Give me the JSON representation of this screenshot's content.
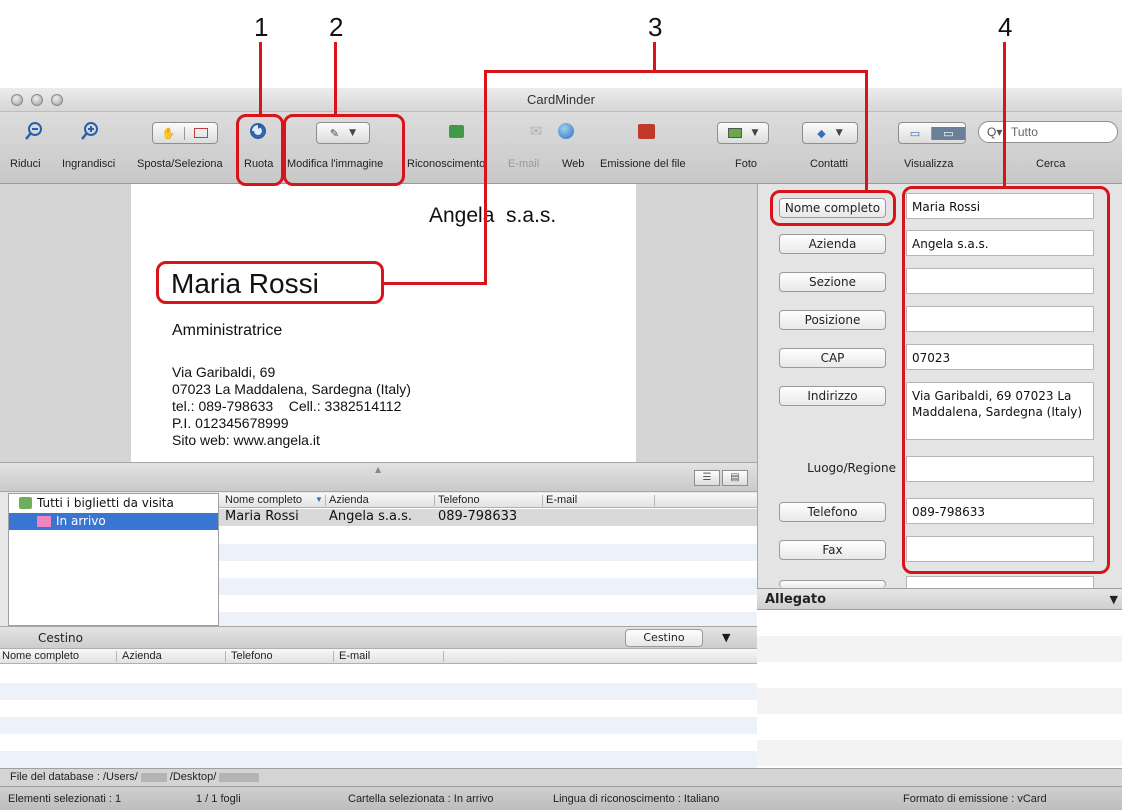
{
  "callouts": [
    "1",
    "2",
    "3",
    "4"
  ],
  "window": {
    "title": "CardMinder"
  },
  "toolbar": {
    "riduci": "Riduci",
    "ingrandisci": "Ingrandisci",
    "sposta": "Sposta/Seleziona",
    "ruota": "Ruota",
    "modifica": "Modifica l'immagine",
    "riconoscimento": "Riconoscimento",
    "email": "E-mail",
    "web": "Web",
    "emissione": "Emissione del file",
    "foto": "Foto",
    "contatti": "Contatti",
    "visualizza": "Visualizza",
    "cerca": "Cerca",
    "search_placeholder": "Tutto"
  },
  "card": {
    "company": "Angela  s.a.s.",
    "name": "Maria Rossi",
    "role": "Amministratrice",
    "address1": "Via Garibaldi, 69",
    "address2": "07023 La Maddalena, Sardegna (Italy)",
    "phones": "tel.: 089-798633    Cell.: 3382514112",
    "piva": "P.I. 012345678999",
    "web": "Sito web: www.angela.it"
  },
  "fields": [
    {
      "label": "Nome completo",
      "value": "Maria Rossi",
      "button": true
    },
    {
      "label": "Azienda",
      "value": "Angela s.a.s.",
      "button": true
    },
    {
      "label": "Sezione",
      "value": "",
      "button": true
    },
    {
      "label": "Posizione",
      "value": "",
      "button": true
    },
    {
      "label": "CAP",
      "value": "07023",
      "button": true
    },
    {
      "label": "Indirizzo",
      "value": "Via Garibaldi, 69 07023 La Maddalena, Sardegna (Italy)",
      "button": true
    },
    {
      "label": "Luogo/Regione",
      "value": "",
      "button": false
    },
    {
      "label": "Telefono",
      "value": "089-798633",
      "button": true
    },
    {
      "label": "Fax",
      "value": "",
      "button": true
    }
  ],
  "attachment": {
    "header": "Allegato"
  },
  "tree": {
    "root": "Tutti i biglietti da visita",
    "inbox": "In arrivo"
  },
  "list": {
    "columns": [
      "Nome completo",
      "Azienda",
      "Telefono",
      "E-mail"
    ],
    "rows": [
      [
        "Maria Rossi",
        "Angela s.a.s.",
        "089-798633",
        ""
      ]
    ]
  },
  "trash": {
    "title": "Cestino",
    "button": "Cestino",
    "columns": [
      "Nome completo",
      "Azienda",
      "Telefono",
      "E-mail"
    ]
  },
  "status": {
    "db_prefix": "File del database : /Users/",
    "db_mid": "/Desktop/",
    "selected": "Elementi selezionati : 1",
    "sheets": "1 / 1 fogli",
    "folder": "Cartella selezionata : In arrivo",
    "language": "Lingua di riconoscimento : Italiano",
    "format": "Formato di emissione : vCard"
  },
  "colors": {
    "callout": "#d7141a",
    "selection": "#3876d2"
  }
}
